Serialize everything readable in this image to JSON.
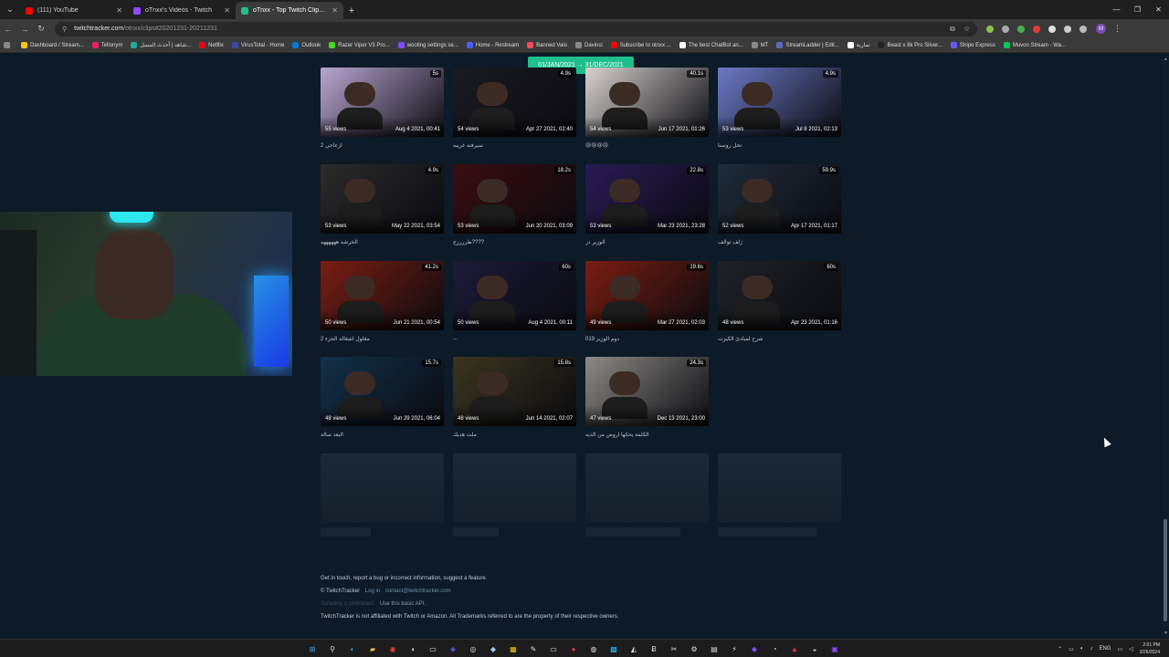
{
  "browser": {
    "tabs": [
      {
        "title": "(111) YouTube",
        "favicon_color": "#ff0000",
        "active": false
      },
      {
        "title": "oTnxx's Videos - Twitch",
        "favicon_color": "#9146ff",
        "active": false
      },
      {
        "title": "oTnxx - Top Twitch Clips - Twitc",
        "favicon_color": "#1fbf8c",
        "active": true
      }
    ],
    "new_tab_label": "+",
    "url_host": "twitchtracker.com",
    "url_path": "/otnxx/clips#20201231-20211231"
  },
  "bookmarks": [
    {
      "label": "Dashboard / Stream...",
      "color": "#f5c518"
    },
    {
      "label": "Tellonym",
      "color": "#e91e63"
    },
    {
      "label": "شاهد | أحدث المسل...",
      "color": "#26a69a"
    },
    {
      "label": "Netflix",
      "color": "#e50914"
    },
    {
      "label": "VirusTotal - Home",
      "color": "#3949ab"
    },
    {
      "label": "Outlook",
      "color": "#0078d4"
    },
    {
      "label": "Razer Viper V3 Pro...",
      "color": "#44d62c"
    },
    {
      "label": "wooting settings se...",
      "color": "#7c4dff"
    },
    {
      "label": "Home - Restream",
      "color": "#4d5cff"
    },
    {
      "label": "Banned Valo",
      "color": "#ff4655"
    },
    {
      "label": "Davinci",
      "color": "#888888"
    },
    {
      "label": "Subscribe to otnxx ...",
      "color": "#ff0000"
    },
    {
      "label": "The best ChatBot an...",
      "color": "#ffffff"
    },
    {
      "label": "MT",
      "color": "#888888"
    },
    {
      "label": "StreamLadder | Edit...",
      "color": "#5c6bc0"
    },
    {
      "label": "تمارية",
      "color": "#ffffff"
    },
    {
      "label": "Beast x 8k Pro Silver...",
      "color": "#222222"
    },
    {
      "label": "Stripe Express",
      "color": "#635bff"
    },
    {
      "label": "Muvon Stream - Wa...",
      "color": "#00c853"
    }
  ],
  "date_range": "01/JAN/2021 → 31/DEC/2021",
  "clips": [
    {
      "views": "55 views",
      "date": "Aug 4 2021, 00:41",
      "duration": "5s",
      "title": "ازعاجي 2",
      "bg": "#b9a6d2"
    },
    {
      "views": "54 views",
      "date": "Apr 27 2021, 02:40",
      "duration": "4.9s",
      "title": "سيرفنه غريبه",
      "bg": "#1a1a22"
    },
    {
      "views": "54 views",
      "date": "Jun 17 2021, 01:26",
      "duration": "40.1s",
      "title": "😢😢😢😢",
      "bg": "#d8d2d0"
    },
    {
      "views": "53 views",
      "date": "Jul 8 2021, 02:13",
      "duration": "4.9s",
      "title": "تحل روسنا",
      "bg": "#6c7ac8"
    },
    {
      "views": "53 views",
      "date": "May 22 2021, 03:54",
      "duration": "4.9s",
      "title": "الخرشه ههههههه",
      "bg": "#2b2b2b"
    },
    {
      "views": "53 views",
      "date": "Jun 20 2021, 03:09",
      "duration": "18.2s",
      "title": "طررررج????",
      "bg": "#3a0d10"
    },
    {
      "views": "53 views",
      "date": "Mar 23 2021, 23:28",
      "duration": "22.8s",
      "title": "الوزير دز",
      "bg": "#2a1a55"
    },
    {
      "views": "52 views",
      "date": "Apr 17 2021, 01:17",
      "duration": "59.9s",
      "title": "ژلف توالف",
      "bg": "#1f2c3a"
    },
    {
      "views": "50 views",
      "date": "Jun 21 2021, 00:54",
      "duration": "41.2s",
      "title": "مغلول اشغالة الجزء 2",
      "bg": "#7a1d12"
    },
    {
      "views": "50 views",
      "date": "Aug 4 2021, 00:11",
      "duration": "60s",
      "title": "...",
      "bg": "#1b1a38"
    },
    {
      "views": "49 views",
      "date": "Mar 27 2021, 02:03",
      "duration": "19.6s",
      "title": "دوم الوزير 019",
      "bg": "#7a1d12"
    },
    {
      "views": "48 views",
      "date": "Apr 23 2021, 01:16",
      "duration": "60s",
      "title": "شرح لمبادئ الكيزت",
      "bg": "#1e2226"
    },
    {
      "views": "48 views",
      "date": "Jun 29 2021, 06:04",
      "duration": "15.7s",
      "title": "البعد سالة",
      "bg": "#12314a"
    },
    {
      "views": "48 views",
      "date": "Jun 14 2021, 02:07",
      "duration": "15.8s",
      "title": "ملت هديك",
      "bg": "#3a3520"
    },
    {
      "views": "47 views",
      "date": "Dec 13 2021, 23:00",
      "duration": "24.3s",
      "title": "الكلمة يحكها اروض من الذيه",
      "bg": "#8d8a86"
    }
  ],
  "footer": {
    "contact_line": "Get in touch, report a bug or incorrect information, suggest a feature.",
    "brand": "© TwitchTracker",
    "login": "Log in",
    "email": "contact@twitchtracker.com",
    "scraping": "Scraping is prohibited.",
    "api": "Use this basic API.",
    "disclaimer": "TwitchTracker is not affiliated with Twitch or Amazon. All Trademarks referred to are the property of their respective owners."
  },
  "taskbar": {
    "lang": "ENG",
    "time": "2:01 PM",
    "date": "3/26/2024"
  }
}
